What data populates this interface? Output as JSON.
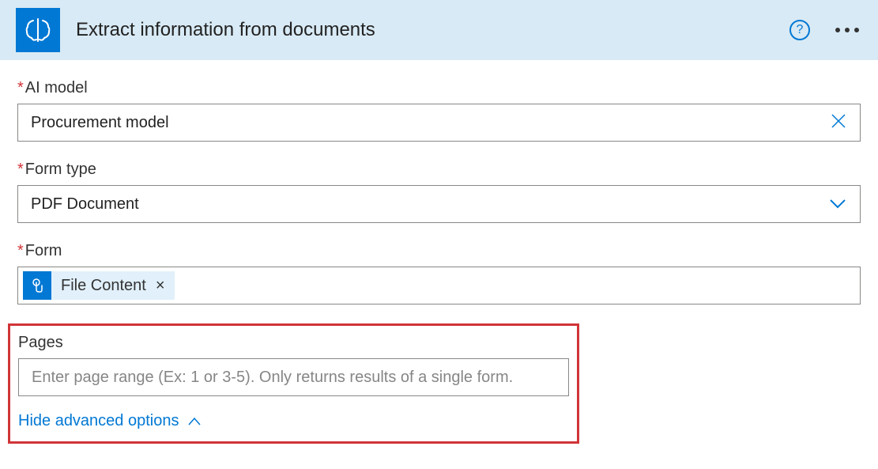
{
  "header": {
    "title": "Extract information from documents"
  },
  "fields": {
    "aiModel": {
      "label": "AI model",
      "value": "Procurement model"
    },
    "formType": {
      "label": "Form type",
      "value": "PDF Document"
    },
    "form": {
      "label": "Form",
      "tokenLabel": "File Content"
    },
    "pages": {
      "label": "Pages",
      "placeholder": "Enter page range (Ex: 1 or 3-5). Only returns results of a single form."
    }
  },
  "hideAdvanced": "Hide advanced options"
}
